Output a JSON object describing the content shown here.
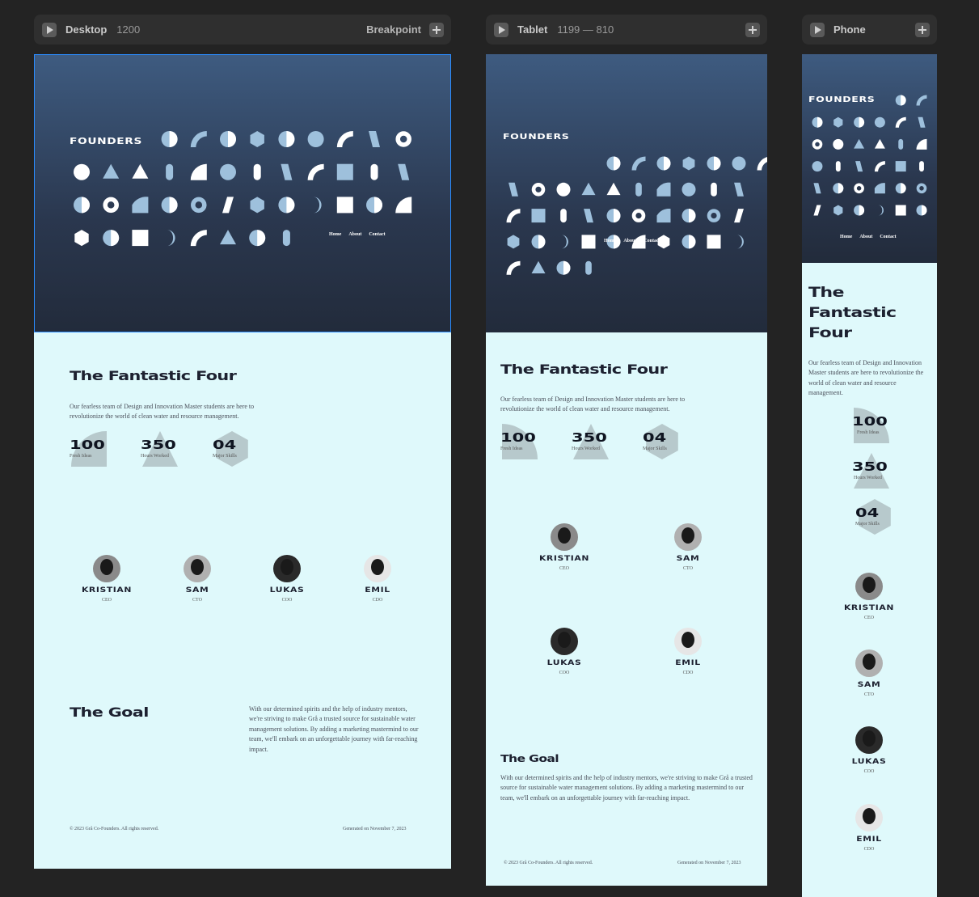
{
  "frames": {
    "desktop": {
      "label": "Desktop",
      "size": "1200",
      "breakpoint": "Breakpoint"
    },
    "tablet": {
      "label": "Tablet",
      "size": "1199 — 810"
    },
    "phone": {
      "label": "Phone"
    }
  },
  "site": {
    "logo": "FOUNDERS",
    "nav": [
      "Home",
      "About",
      "Contact"
    ],
    "title": "The Fantastic Four",
    "title_phone": [
      "The",
      "Fantastic",
      "Four"
    ],
    "intro": "Our fearless team of Design and Innovation Master students are here to revolutionize the world of clean water and resource management.",
    "stats": [
      {
        "num": "100",
        "cap": "Fresh Ideas",
        "shape": "quarter"
      },
      {
        "num": "350",
        "cap": "Hours Worked",
        "shape": "triangle"
      },
      {
        "num": "04",
        "cap": "Major Skills",
        "shape": "hexagon"
      }
    ],
    "team": [
      {
        "name": "KRISTIAN",
        "role": "CEO"
      },
      {
        "name": "SAM",
        "role": "CTO"
      },
      {
        "name": "LUKAS",
        "role": "COO"
      },
      {
        "name": "EMIL",
        "role": "CDO"
      }
    ],
    "goal_title": "The Goal",
    "goal_text": "With our determined spirits and the help of industry mentors, we're striving to make Grå a trusted source for sustainable water management solutions. By adding a marketing mastermind to our team, we'll embark on an unforgettable journey with far-reaching impact.",
    "copyright": "© 2023 Grå Co-Founders. All rights reserved.",
    "generated": "Generated on November 7, 2023"
  },
  "colors": {
    "hero_top": "#3e5b80",
    "hero_bottom": "#222b3b",
    "light_bg": "#dff9fb",
    "shape_light": "#9ec0dc",
    "shape_white": "#ffffff",
    "selection": "#2a8cff"
  }
}
